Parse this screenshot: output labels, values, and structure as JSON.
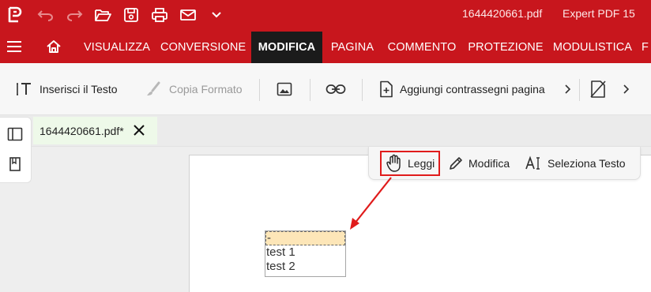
{
  "app": {
    "document_title": "1644420661.pdf",
    "app_name": "Expert PDF 15",
    "brand_color": "#c8161d"
  },
  "quick_access": [
    {
      "name": "app-logo-icon"
    },
    {
      "name": "undo-icon"
    },
    {
      "name": "redo-icon"
    },
    {
      "name": "open-folder-icon"
    },
    {
      "name": "save-icon"
    },
    {
      "name": "print-icon"
    },
    {
      "name": "email-icon"
    },
    {
      "name": "chevron-down-icon"
    }
  ],
  "menu": {
    "tabs": [
      {
        "label": "VISUALIZZA"
      },
      {
        "label": "CONVERSIONE"
      },
      {
        "label": "MODIFICA",
        "active": true
      },
      {
        "label": "PAGINA"
      },
      {
        "label": "COMMENTO"
      },
      {
        "label": "PROTEZIONE"
      },
      {
        "label": "MODULISTICA"
      },
      {
        "label": "F"
      }
    ]
  },
  "ribbon": {
    "insert_text": "Inserisci il Testo",
    "copy_format": "Copia Formato",
    "add_page_marks": "Aggiungi contrassegni pagina"
  },
  "document_tab": {
    "label": "1644420661.pdf*"
  },
  "mode_toolbar": {
    "read": "Leggi",
    "edit": "Modifica",
    "select_text": "Seleziona Testo",
    "highlight_color": "#e01b1b"
  },
  "form_listbox": {
    "items": [
      "-",
      "test 1",
      "test 2"
    ],
    "selected_index": 0
  }
}
